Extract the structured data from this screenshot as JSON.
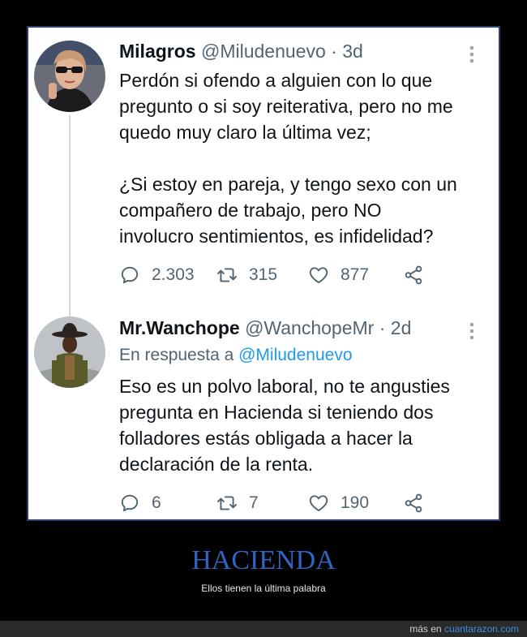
{
  "tweets": [
    {
      "name": "Milagros",
      "handle": "@Miludenuevo",
      "age": "· 3d",
      "lines": [
        "Perdón si ofendo a alguien con lo que",
        "pregunto o si soy reiterativa, pero no me",
        "quedo muy claro la última vez;",
        "",
        "¿Si estoy en pareja, y tengo sexo con un",
        "compañero de trabajo, pero NO",
        "involucro sentimientos, es infidelidad?"
      ],
      "replies": "2.303",
      "retweets": "315",
      "likes": "877"
    },
    {
      "name": "Mr.Wanchope",
      "handle": "@WanchopeMr",
      "age": "· 2d",
      "reply_prefix": "En respuesta a",
      "reply_handle": "@Miludenuevo",
      "lines": [
        "Eso es un polvo laboral, no te angusties",
        "pregunta en Hacienda si teniendo dos",
        "folladores estás obligada a hacer la",
        "declaración de la renta."
      ],
      "replies": "6",
      "retweets": "7",
      "likes": "190"
    }
  ],
  "caption": {
    "title": "HACIENDA",
    "subtitle": "Ellos tienen la última palabra"
  },
  "footer": {
    "prefix": "más en",
    "site": "cuantarazon.com"
  },
  "colors": {
    "link": "#1d9bf0",
    "title": "#2f64c0",
    "muted": "#536471"
  },
  "icons": [
    "reply-icon",
    "retweet-icon",
    "like-icon",
    "share-icon",
    "more-icon"
  ]
}
